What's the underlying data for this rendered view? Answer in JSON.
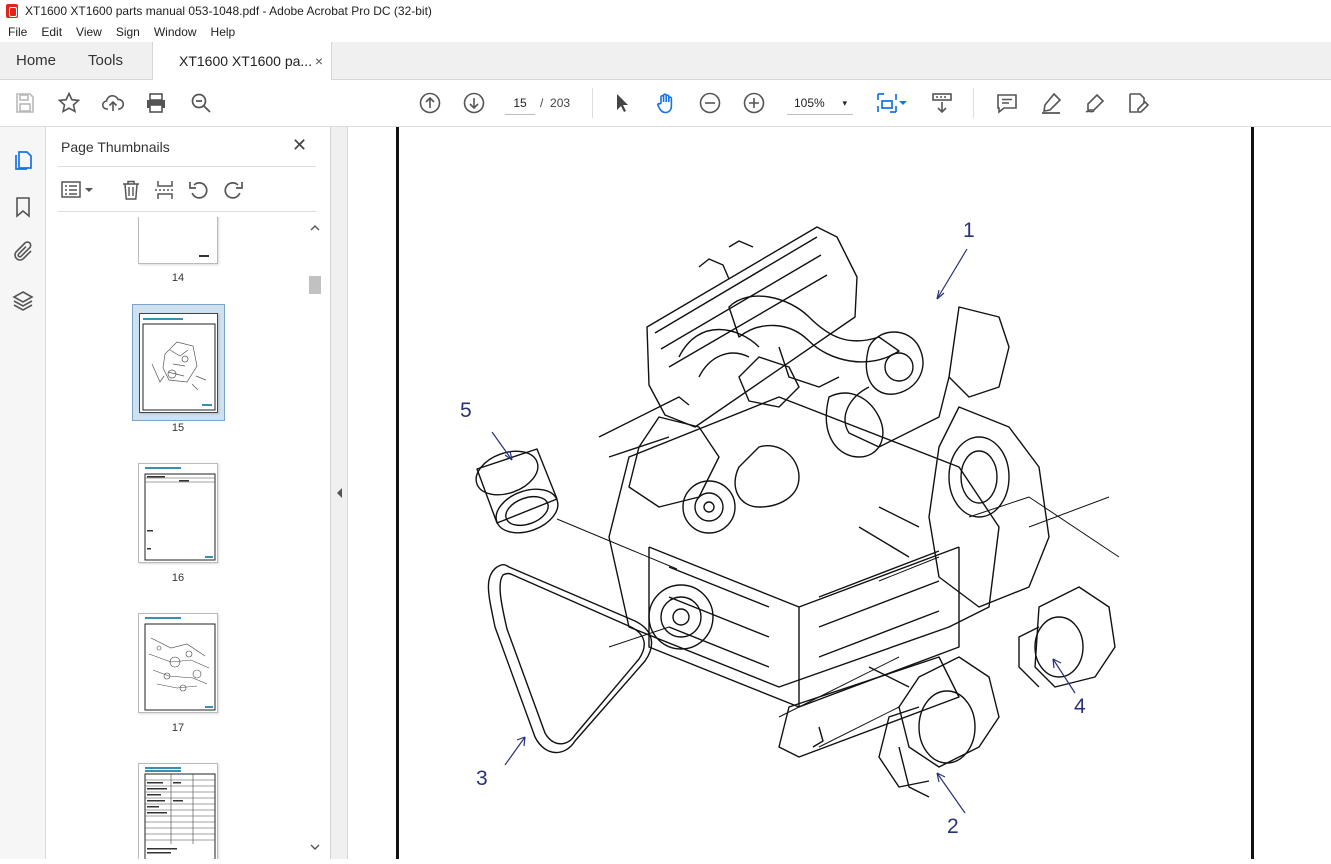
{
  "window": {
    "title": "XT1600 XT1600 parts manual 053-1048.pdf - Adobe Acrobat Pro DC (32-bit)"
  },
  "menu": [
    "File",
    "Edit",
    "View",
    "Sign",
    "Window",
    "Help"
  ],
  "tabs": {
    "home": "Home",
    "tools": "Tools",
    "document": "XT1600 XT1600 pa...",
    "close": "×"
  },
  "toolbar": {
    "current_page": "15",
    "page_separator": "/",
    "total_pages": "203",
    "zoom": "105%",
    "zoom_caret": "▾"
  },
  "panel": {
    "title": "Page Thumbnails",
    "close": "✕",
    "thumbnails": [
      {
        "label": "14"
      },
      {
        "label": "15",
        "selected": true
      },
      {
        "label": "16"
      },
      {
        "label": "17"
      },
      {
        "label": ""
      }
    ]
  },
  "document": {
    "callouts": [
      "1",
      "2",
      "3",
      "4",
      "5"
    ]
  },
  "colors": {
    "accent": "#1473e6",
    "callout": "#28327a",
    "scrollthumb": "#c1c1c1"
  }
}
